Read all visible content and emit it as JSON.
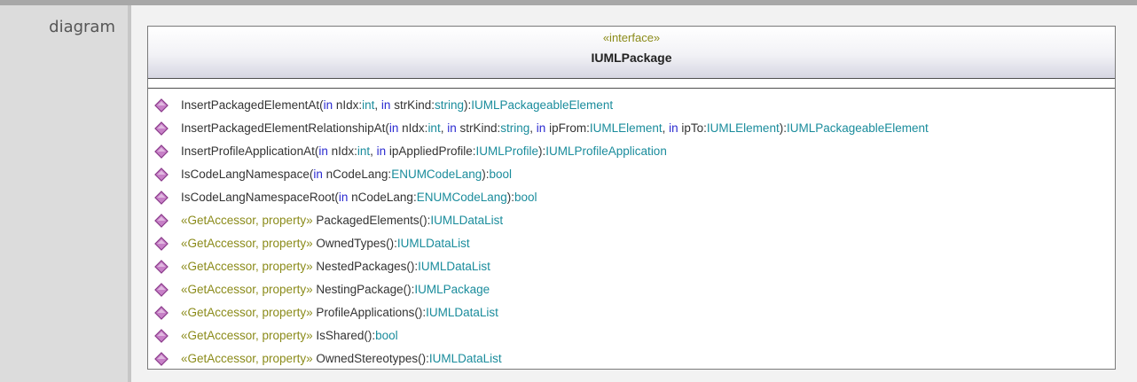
{
  "section_label": "diagram",
  "colors": {
    "keyword": "#2a2ad0",
    "type": "#1a8c9c",
    "stereotype": "#8b8b1a",
    "text": "#333333",
    "icon_fill": "#c780c7",
    "icon_stroke": "#8a3a8a"
  },
  "classifier": {
    "stereotype": "«interface»",
    "name": "IUMLPackage",
    "operations": [
      {
        "parts": [
          {
            "t": "plain",
            "v": "InsertPackagedElementAt("
          },
          {
            "t": "kw",
            "v": "in"
          },
          {
            "t": "plain",
            "v": " nIdx:"
          },
          {
            "t": "type",
            "v": "int"
          },
          {
            "t": "plain",
            "v": ", "
          },
          {
            "t": "kw",
            "v": "in"
          },
          {
            "t": "plain",
            "v": " strKind:"
          },
          {
            "t": "type",
            "v": "string"
          },
          {
            "t": "plain",
            "v": "):"
          },
          {
            "t": "type",
            "v": "IUMLPackageableElement"
          }
        ]
      },
      {
        "parts": [
          {
            "t": "plain",
            "v": "InsertPackagedElementRelationshipAt("
          },
          {
            "t": "kw",
            "v": "in"
          },
          {
            "t": "plain",
            "v": " nIdx:"
          },
          {
            "t": "type",
            "v": "int"
          },
          {
            "t": "plain",
            "v": ", "
          },
          {
            "t": "kw",
            "v": "in"
          },
          {
            "t": "plain",
            "v": " strKind:"
          },
          {
            "t": "type",
            "v": "string"
          },
          {
            "t": "plain",
            "v": ", "
          },
          {
            "t": "kw",
            "v": "in"
          },
          {
            "t": "plain",
            "v": " ipFrom:"
          },
          {
            "t": "type",
            "v": "IUMLElement"
          },
          {
            "t": "plain",
            "v": ", "
          },
          {
            "t": "kw",
            "v": "in"
          },
          {
            "t": "plain",
            "v": " ipTo:"
          },
          {
            "t": "type",
            "v": "IUMLElement"
          },
          {
            "t": "plain",
            "v": "):"
          },
          {
            "t": "type",
            "v": "IUMLPackageableElement"
          }
        ]
      },
      {
        "parts": [
          {
            "t": "plain",
            "v": "InsertProfileApplicationAt("
          },
          {
            "t": "kw",
            "v": "in"
          },
          {
            "t": "plain",
            "v": " nIdx:"
          },
          {
            "t": "type",
            "v": "int"
          },
          {
            "t": "plain",
            "v": ", "
          },
          {
            "t": "kw",
            "v": "in"
          },
          {
            "t": "plain",
            "v": " ipAppliedProfile:"
          },
          {
            "t": "type",
            "v": "IUMLProfile"
          },
          {
            "t": "plain",
            "v": "):"
          },
          {
            "t": "type",
            "v": "IUMLProfileApplication"
          }
        ]
      },
      {
        "parts": [
          {
            "t": "plain",
            "v": "IsCodeLangNamespace("
          },
          {
            "t": "kw",
            "v": "in"
          },
          {
            "t": "plain",
            "v": " nCodeLang:"
          },
          {
            "t": "type",
            "v": "ENUMCodeLang"
          },
          {
            "t": "plain",
            "v": "):"
          },
          {
            "t": "type",
            "v": "bool"
          }
        ]
      },
      {
        "parts": [
          {
            "t": "plain",
            "v": "IsCodeLangNamespaceRoot("
          },
          {
            "t": "kw",
            "v": "in"
          },
          {
            "t": "plain",
            "v": " nCodeLang:"
          },
          {
            "t": "type",
            "v": "ENUMCodeLang"
          },
          {
            "t": "plain",
            "v": "):"
          },
          {
            "t": "type",
            "v": "bool"
          }
        ]
      },
      {
        "parts": [
          {
            "t": "st",
            "v": "«GetAccessor, property»"
          },
          {
            "t": "plain",
            "v": " PackagedElements():"
          },
          {
            "t": "type",
            "v": "IUMLDataList"
          }
        ]
      },
      {
        "parts": [
          {
            "t": "st",
            "v": "«GetAccessor, property»"
          },
          {
            "t": "plain",
            "v": " OwnedTypes():"
          },
          {
            "t": "type",
            "v": "IUMLDataList"
          }
        ]
      },
      {
        "parts": [
          {
            "t": "st",
            "v": "«GetAccessor, property»"
          },
          {
            "t": "plain",
            "v": " NestedPackages():"
          },
          {
            "t": "type",
            "v": "IUMLDataList"
          }
        ]
      },
      {
        "parts": [
          {
            "t": "st",
            "v": "«GetAccessor, property»"
          },
          {
            "t": "plain",
            "v": " NestingPackage():"
          },
          {
            "t": "type",
            "v": "IUMLPackage"
          }
        ]
      },
      {
        "parts": [
          {
            "t": "st",
            "v": "«GetAccessor, property»"
          },
          {
            "t": "plain",
            "v": " ProfileApplications():"
          },
          {
            "t": "type",
            "v": "IUMLDataList"
          }
        ]
      },
      {
        "parts": [
          {
            "t": "st",
            "v": "«GetAccessor, property»"
          },
          {
            "t": "plain",
            "v": " IsShared():"
          },
          {
            "t": "type",
            "v": "bool"
          }
        ]
      },
      {
        "parts": [
          {
            "t": "st",
            "v": "«GetAccessor, property»"
          },
          {
            "t": "plain",
            "v": " OwnedStereotypes():"
          },
          {
            "t": "type",
            "v": "IUMLDataList"
          }
        ]
      }
    ]
  }
}
